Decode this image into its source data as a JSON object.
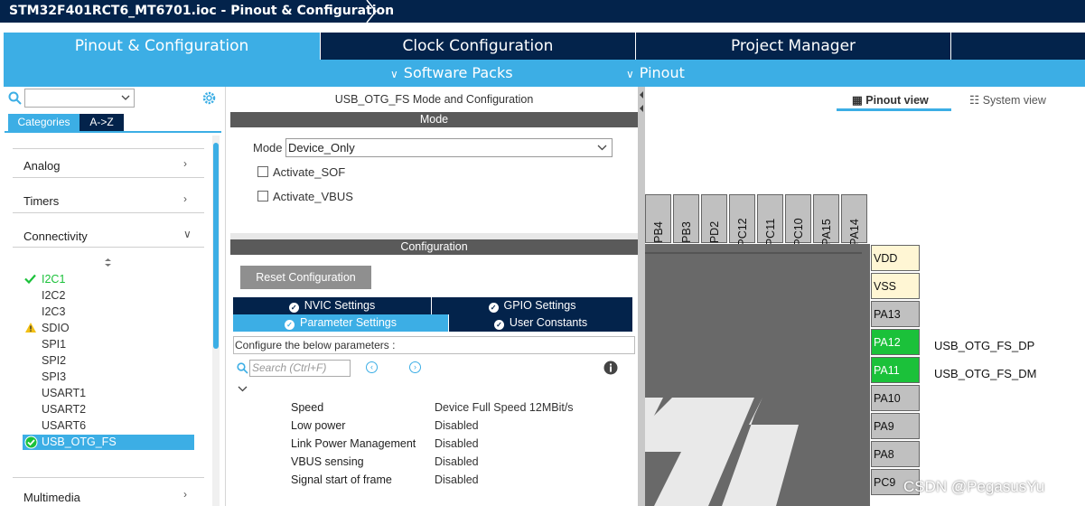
{
  "window": {
    "title": "STM32F401RCT6_MT6701.ioc - Pinout & Configuration"
  },
  "main_tabs": [
    "Pinout & Configuration",
    "Clock Configuration",
    "Project Manager"
  ],
  "sub_menu": {
    "software_packs": "Software Packs",
    "pinout": "Pinout"
  },
  "left": {
    "category_tabs": [
      "Categories",
      "A->Z"
    ],
    "categories": [
      "Analog",
      "Timers",
      "Connectivity",
      "Multimedia"
    ],
    "peripherals": [
      {
        "label": "I2C1",
        "state": "ok"
      },
      {
        "label": "I2C2",
        "state": ""
      },
      {
        "label": "I2C3",
        "state": ""
      },
      {
        "label": "SDIO",
        "state": "warning"
      },
      {
        "label": "SPI1",
        "state": ""
      },
      {
        "label": "SPI2",
        "state": ""
      },
      {
        "label": "SPI3",
        "state": ""
      },
      {
        "label": "USART1",
        "state": ""
      },
      {
        "label": "USART2",
        "state": ""
      },
      {
        "label": "USART6",
        "state": ""
      },
      {
        "label": "USB_OTG_FS",
        "state": "selected-ok"
      }
    ]
  },
  "mode_panel": {
    "title": "USB_OTG_FS Mode and Configuration",
    "mode_header": "Mode",
    "mode_label": "Mode",
    "mode_value": "Device_Only",
    "checkboxes": [
      "Activate_SOF",
      "Activate_VBUS"
    ]
  },
  "config_panel": {
    "header": "Configuration",
    "reset_button": "Reset Configuration",
    "tabs": [
      "NVIC Settings",
      "GPIO Settings",
      "Parameter Settings",
      "User Constants"
    ],
    "instructions": "Configure the below parameters :",
    "search_placeholder": "Search (Ctrl+F)",
    "parameters": [
      {
        "name": "Speed",
        "value": "Device Full Speed 12MBit/s"
      },
      {
        "name": "Low power",
        "value": "Disabled"
      },
      {
        "name": "Link Power Management",
        "value": "Disabled"
      },
      {
        "name": "VBUS sensing",
        "value": "Disabled"
      },
      {
        "name": "Signal start of frame",
        "value": "Disabled"
      }
    ]
  },
  "chip_view": {
    "view_buttons": [
      "Pinout view",
      "System view"
    ],
    "top_pins": [
      "PB4",
      "PB3",
      "PD2",
      "PC12",
      "PC11",
      "PC10",
      "PA15",
      "PA14"
    ],
    "right_pins": [
      {
        "name": "VDD",
        "kind": "power",
        "signal": ""
      },
      {
        "name": "VSS",
        "kind": "power",
        "signal": ""
      },
      {
        "name": "PA13",
        "kind": "io",
        "signal": ""
      },
      {
        "name": "PA12",
        "kind": "assigned",
        "signal": "USB_OTG_FS_DP"
      },
      {
        "name": "PA11",
        "kind": "assigned",
        "signal": "USB_OTG_FS_DM"
      },
      {
        "name": "PA10",
        "kind": "io",
        "signal": ""
      },
      {
        "name": "PA9",
        "kind": "io",
        "signal": ""
      },
      {
        "name": "PA8",
        "kind": "io",
        "signal": ""
      },
      {
        "name": "PC9",
        "kind": "io",
        "signal": ""
      }
    ],
    "colors": {
      "assigned": "#1bc13a",
      "power": "#fff6d4",
      "io": "#c0c0c0"
    }
  },
  "watermark": "CSDN @PegasusYu",
  "colors": {
    "navy": "#03234b",
    "accent": "#3caee5"
  }
}
